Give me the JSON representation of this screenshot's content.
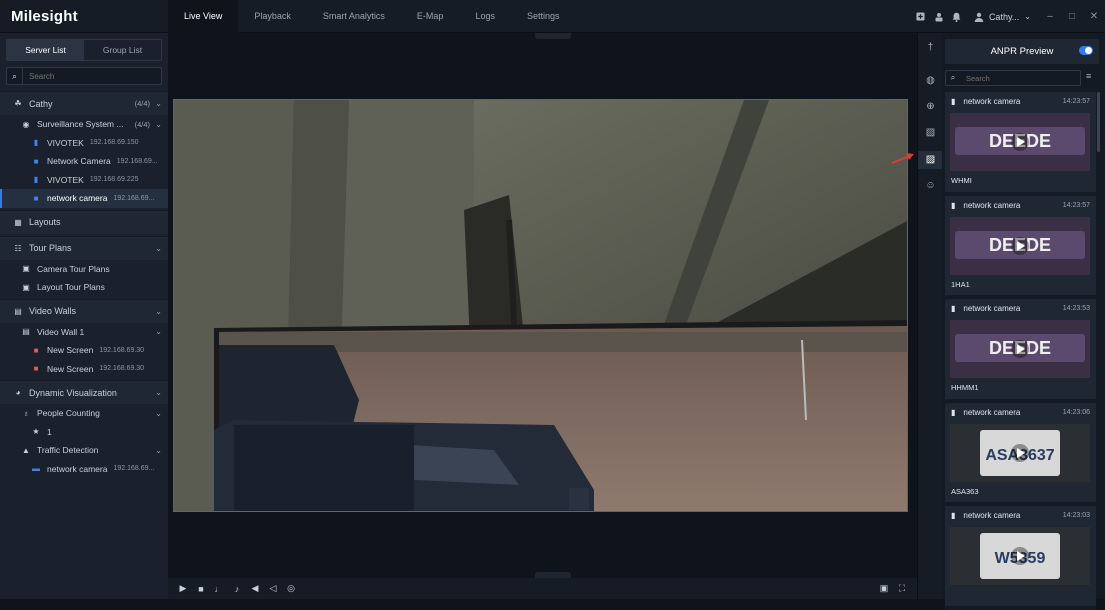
{
  "app": {
    "logo": "Milesight"
  },
  "nav": {
    "tabs": [
      "Live View",
      "Playback",
      "Smart Analytics",
      "E-Map",
      "Logs",
      "Settings"
    ],
    "active": "Live View"
  },
  "header": {
    "user": "Cathy..."
  },
  "sidebar": {
    "segments": [
      "Server List",
      "Group List"
    ],
    "search_placeholder": "Search",
    "cathy": {
      "label": "Cathy",
      "count": "(4/4)"
    },
    "system": {
      "label": "Surveillance System ...",
      "count": "(4/4)"
    },
    "devices": [
      {
        "name": "VIVOTEK",
        "ip": "192.168.69.150"
      },
      {
        "name": "Network Camera",
        "ip": "192.168.69..."
      },
      {
        "name": "VIVOTEK",
        "ip": "192.168.69.225"
      },
      {
        "name": "network camera",
        "ip": "192.168.69..."
      }
    ],
    "layouts": "Layouts",
    "tour_plans": "Tour Plans",
    "camera_tour": "Camera Tour Plans",
    "layout_tour": "Layout Tour Plans",
    "video_walls": "Video Walls",
    "video_wall_1": "Video Wall 1",
    "screens": [
      {
        "name": "New Screen",
        "ip": "192.168.69.30"
      },
      {
        "name": "New Screen",
        "ip": "192.168.69.30"
      }
    ],
    "dynamic": "Dynamic Visualization",
    "people": "People Counting",
    "people_item": "1",
    "traffic": "Traffic Detection",
    "traffic_item": {
      "name": "network camera",
      "ip": "192.168.69..."
    }
  },
  "anpr": {
    "title": "ANPR Preview",
    "enabled": true,
    "search_placeholder": "Search",
    "entries": [
      {
        "camera": "network camera",
        "time": "14:23:57",
        "plate": "WHMI",
        "img_text": "DEEDE"
      },
      {
        "camera": "network camera",
        "time": "14:23:57",
        "plate": "1HA1",
        "img_text": "DEEDE"
      },
      {
        "camera": "network camera",
        "time": "14:23:53",
        "plate": "HHMM1",
        "img_text": "DEEDE"
      },
      {
        "camera": "network camera",
        "time": "14:23:06",
        "plate": "ASA363",
        "img_text": "ASA3637"
      },
      {
        "camera": "network camera",
        "time": "14:23:03",
        "plate": "",
        "img_text": "W5359"
      }
    ]
  },
  "colors": {
    "accent": "#2f7df6",
    "arrow": "#e53935",
    "bg": "#0f141c",
    "panel": "#1a212c"
  }
}
